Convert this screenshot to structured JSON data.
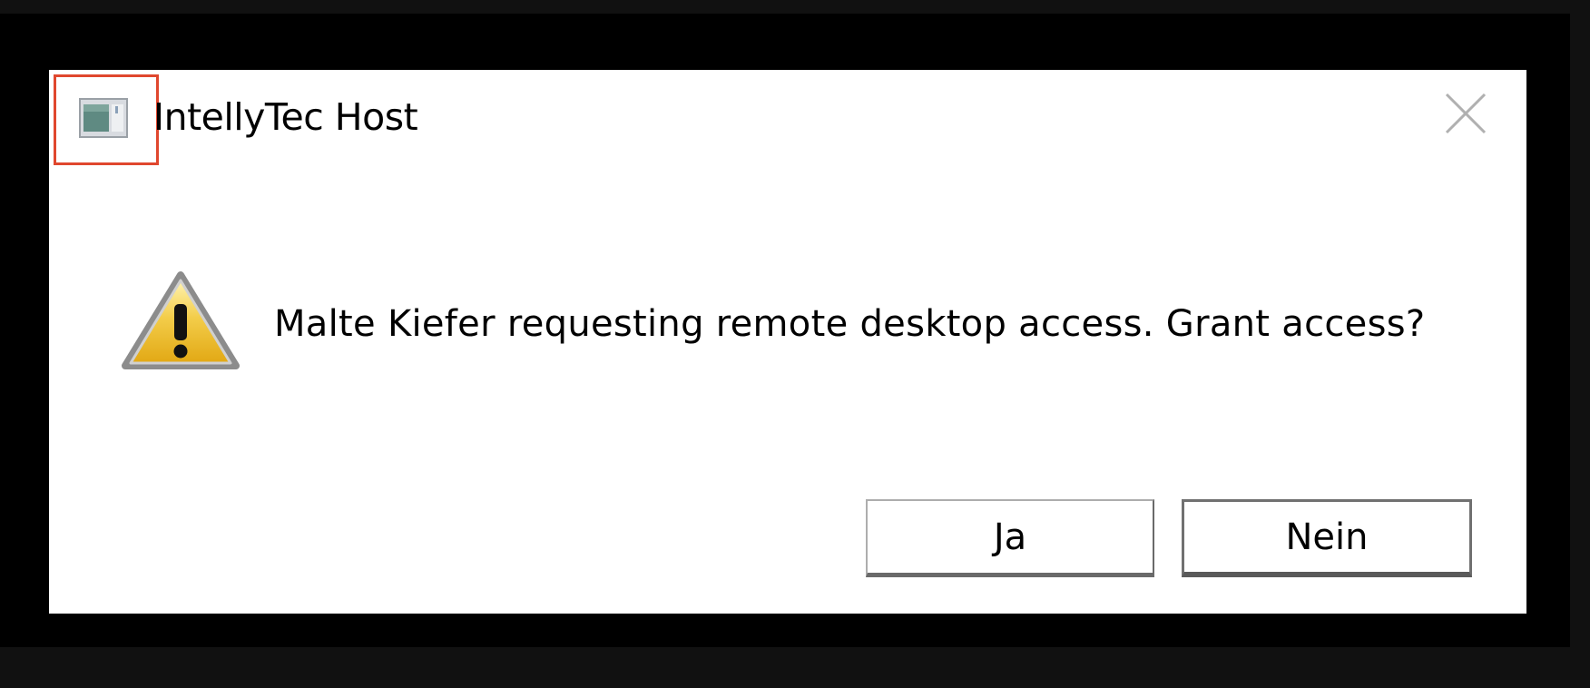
{
  "dialog": {
    "title": "IntellyTec Host",
    "message": "Malte Kiefer requesting remote desktop access. Grant access?",
    "app_icon": "application-window-icon",
    "message_icon": "warning-icon",
    "close_icon": "close-icon",
    "buttons": {
      "yes_label": "Ja",
      "no_label": "Nein"
    }
  },
  "colors": {
    "page_background": "#111111",
    "screen_background": "#000000",
    "dialog_background": "#ffffff",
    "highlight": "#e0472e",
    "warning_fill": "#f3c53a"
  }
}
